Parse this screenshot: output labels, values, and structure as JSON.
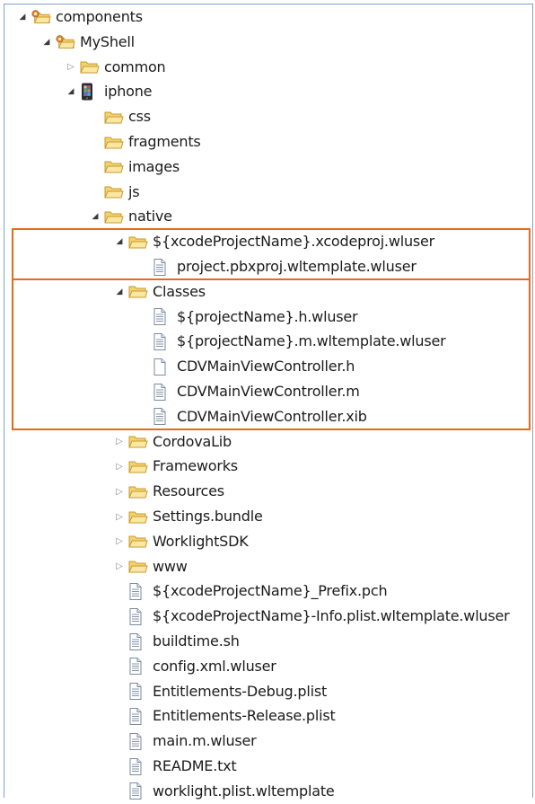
{
  "tree": [
    {
      "label": "components",
      "depth": 0,
      "expand": "open",
      "icon": "package-folder-icon"
    },
    {
      "label": "MyShell",
      "depth": 1,
      "expand": "open",
      "icon": "package-folder-icon"
    },
    {
      "label": "common",
      "depth": 2,
      "expand": "closed",
      "icon": "folder-icon"
    },
    {
      "label": "iphone",
      "depth": 2,
      "expand": "open",
      "icon": "iphone-device-icon"
    },
    {
      "label": "css",
      "depth": 3,
      "expand": "none",
      "icon": "folder-icon"
    },
    {
      "label": "fragments",
      "depth": 3,
      "expand": "none",
      "icon": "folder-icon"
    },
    {
      "label": "images",
      "depth": 3,
      "expand": "none",
      "icon": "folder-icon"
    },
    {
      "label": "js",
      "depth": 3,
      "expand": "none",
      "icon": "folder-icon"
    },
    {
      "label": "native",
      "depth": 3,
      "expand": "open",
      "icon": "folder-icon"
    },
    {
      "label": "${xcodeProjectName}.xcodeproj.wluser",
      "depth": 4,
      "expand": "open",
      "icon": "folder-icon"
    },
    {
      "label": "project.pbxproj.wltemplate.wluser",
      "depth": 5,
      "expand": "none",
      "icon": "text-file-icon"
    },
    {
      "label": "Classes",
      "depth": 4,
      "expand": "open",
      "icon": "folder-icon"
    },
    {
      "label": "${projectName}.h.wluser",
      "depth": 5,
      "expand": "none",
      "icon": "text-file-icon"
    },
    {
      "label": "${projectName}.m.wltemplate.wluser",
      "depth": 5,
      "expand": "none",
      "icon": "text-file-icon"
    },
    {
      "label": "CDVMainViewController.h",
      "depth": 5,
      "expand": "none",
      "icon": "blank-file-icon"
    },
    {
      "label": "CDVMainViewController.m",
      "depth": 5,
      "expand": "none",
      "icon": "text-file-icon"
    },
    {
      "label": "CDVMainViewController.xib",
      "depth": 5,
      "expand": "none",
      "icon": "text-file-icon"
    },
    {
      "label": "CordovaLib",
      "depth": 4,
      "expand": "closed",
      "icon": "folder-icon"
    },
    {
      "label": "Frameworks",
      "depth": 4,
      "expand": "closed",
      "icon": "folder-icon"
    },
    {
      "label": "Resources",
      "depth": 4,
      "expand": "closed",
      "icon": "folder-icon"
    },
    {
      "label": "Settings.bundle",
      "depth": 4,
      "expand": "closed",
      "icon": "folder-icon"
    },
    {
      "label": "WorklightSDK",
      "depth": 4,
      "expand": "closed",
      "icon": "folder-icon"
    },
    {
      "label": "www",
      "depth": 4,
      "expand": "closed",
      "icon": "folder-icon"
    },
    {
      "label": "${xcodeProjectName}_Prefix.pch",
      "depth": 4,
      "expand": "none",
      "icon": "text-file-icon"
    },
    {
      "label": "${xcodeProjectName}-Info.plist.wltemplate.wluser",
      "depth": 4,
      "expand": "none",
      "icon": "text-file-icon"
    },
    {
      "label": "buildtime.sh",
      "depth": 4,
      "expand": "none",
      "icon": "text-file-icon"
    },
    {
      "label": "config.xml.wluser",
      "depth": 4,
      "expand": "none",
      "icon": "text-file-icon"
    },
    {
      "label": "Entitlements-Debug.plist",
      "depth": 4,
      "expand": "none",
      "icon": "text-file-icon"
    },
    {
      "label": "Entitlements-Release.plist",
      "depth": 4,
      "expand": "none",
      "icon": "text-file-icon"
    },
    {
      "label": "main.m.wluser",
      "depth": 4,
      "expand": "none",
      "icon": "text-file-icon"
    },
    {
      "label": "README.txt",
      "depth": 4,
      "expand": "none",
      "icon": "text-file-icon"
    },
    {
      "label": "worklight.plist.wltemplate",
      "depth": 4,
      "expand": "none",
      "icon": "text-file-icon"
    }
  ],
  "highlights": [
    {
      "from": 9,
      "to": 10
    },
    {
      "from": 11,
      "to": 16
    }
  ],
  "colors": {
    "highlight_border": "#e56a1c",
    "panel_border": "#7da2ce",
    "folder_fill": "#f3d36e",
    "folder_stroke": "#c99a2e"
  }
}
